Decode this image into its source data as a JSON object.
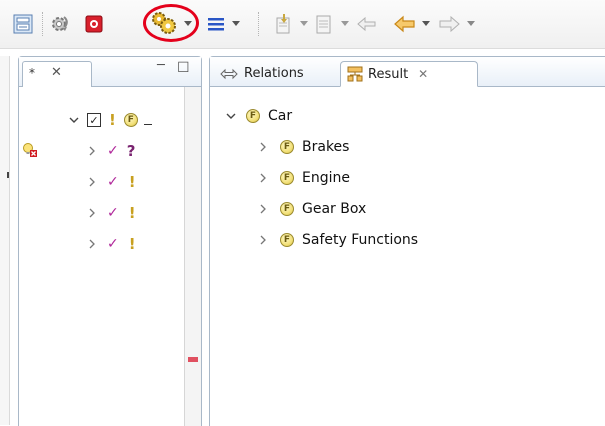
{
  "colors": {
    "accent_circle": "#e4001b",
    "check_mark": "#b0279a",
    "feature_fill": "#f2e07a",
    "tab_border": "#a9b8c8"
  },
  "toolbar": {
    "icons": [
      "view-layout-icon",
      "refresh-gear-icon",
      "record-stop-icon",
      "multi-gear-icon",
      "list-menu-icon",
      "document-down-icon",
      "document-icon",
      "back-arrow-icon",
      "orange-left-arrow-icon",
      "right-arrow-icon"
    ]
  },
  "left_view": {
    "tab_dirty_marker": "*",
    "tab_close_glyph": "✕",
    "minimize_glyph": "─",
    "maximize_glyph": "☐",
    "root": {
      "checkbox": "checked",
      "bang": "!",
      "feature_letter": "F"
    },
    "children": [
      {
        "check": "✓",
        "flag": "?"
      },
      {
        "check": "✓",
        "flag": "!"
      },
      {
        "check": "✓",
        "flag": "!"
      },
      {
        "check": "✓",
        "flag": "!"
      }
    ]
  },
  "right_view": {
    "tabs": [
      {
        "label": "Relations",
        "active": false
      },
      {
        "label": "Result",
        "active": true,
        "close": "✕"
      }
    ],
    "tree": {
      "root": {
        "letter": "F",
        "label": "Car",
        "expanded": true
      },
      "children": [
        {
          "letter": "F",
          "label": "Brakes"
        },
        {
          "letter": "F",
          "label": "Engine"
        },
        {
          "letter": "F",
          "label": "Gear Box"
        },
        {
          "letter": "F",
          "label": "Safety Functions"
        }
      ]
    }
  }
}
